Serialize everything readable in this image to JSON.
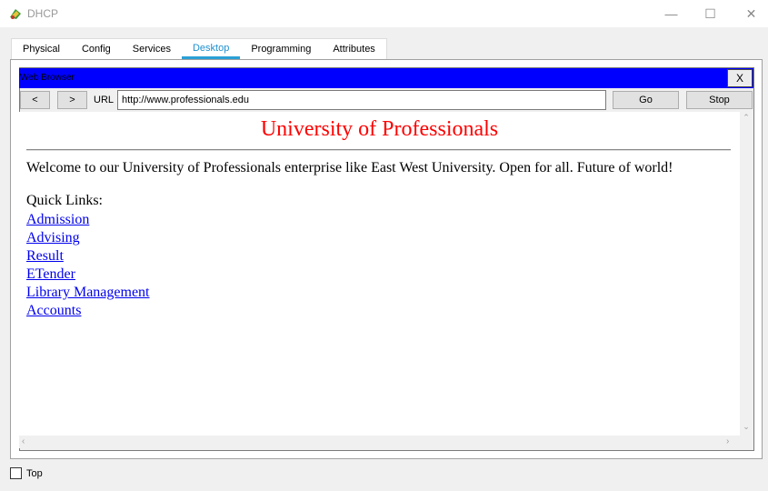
{
  "window": {
    "title": "DHCP",
    "minimize_glyph": "—",
    "maximize_glyph": "☐",
    "close_glyph": "✕"
  },
  "tabs": [
    {
      "label": "Physical",
      "active": false
    },
    {
      "label": "Config",
      "active": false
    },
    {
      "label": "Services",
      "active": false
    },
    {
      "label": "Desktop",
      "active": true
    },
    {
      "label": "Programming",
      "active": false
    },
    {
      "label": "Attributes",
      "active": false
    }
  ],
  "browser": {
    "title": "Web Browser",
    "close_label": "X",
    "back_label": "<",
    "forward_label": ">",
    "url_label": "URL",
    "url_value": "http://www.professionals.edu",
    "go_label": "Go",
    "stop_label": "Stop"
  },
  "page": {
    "heading": "University of Professionals",
    "welcome": "Welcome to our University of Professionals enterprise like East West University. Open for all. Future of world!",
    "quick_links_title": "Quick Links:",
    "links": [
      "Admission",
      "Advising",
      "Result",
      "ETender",
      "Library Management",
      "Accounts"
    ]
  },
  "footer": {
    "top_label": "Top",
    "top_checked": false
  },
  "colors": {
    "title_bar_blue": "#0000ff",
    "heading_red": "#ff0000",
    "link_blue": "#0000ee",
    "active_tab": "#1e90d0"
  }
}
